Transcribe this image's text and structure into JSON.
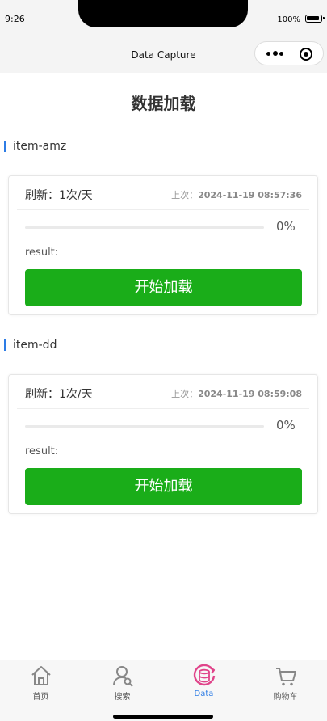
{
  "status": {
    "time": "9:26",
    "battery": "100%"
  },
  "nav": {
    "title": "Data Capture"
  },
  "page": {
    "title": "数据加载"
  },
  "sections": [
    {
      "label": "item-amz",
      "refresh": "刷新：1次/天",
      "last_prefix": "上次：",
      "last_time": "2024-11-19 08:57:36",
      "progress": "0%",
      "progress_value": 0,
      "result": "result:",
      "button": "开始加载"
    },
    {
      "label": "item-dd",
      "refresh": "刷新：1次/天",
      "last_prefix": "上次：",
      "last_time": "2024-11-19 08:59:08",
      "progress": "0%",
      "progress_value": 0,
      "result": "result:",
      "button": "开始加载"
    }
  ],
  "tabbar": {
    "items": [
      {
        "label": "首页",
        "icon": "home-icon"
      },
      {
        "label": "搜索",
        "icon": "search-user-icon"
      },
      {
        "label": "Data",
        "icon": "database-refresh-icon",
        "active": true
      },
      {
        "label": "购物车",
        "icon": "cart-icon"
      }
    ]
  },
  "colors": {
    "accent": "#1aad19",
    "active_tab": "#2d7ce5",
    "data_icon": "#e0448a"
  }
}
